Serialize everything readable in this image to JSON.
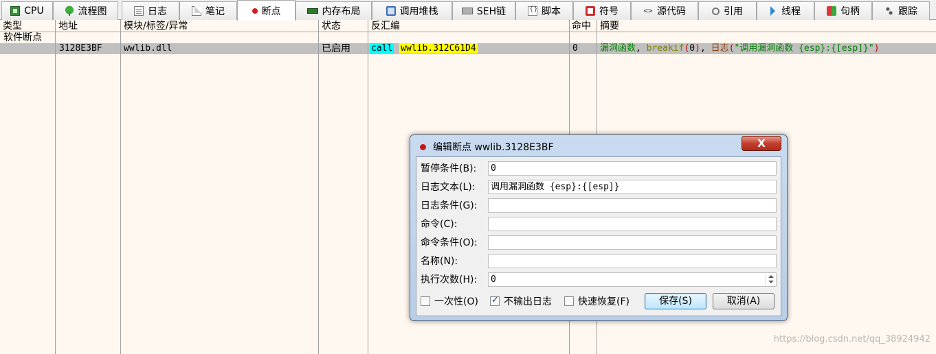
{
  "tabs": [
    {
      "label": "CPU",
      "icon": "cpu-icon"
    },
    {
      "label": "流程图",
      "icon": "graph-icon"
    },
    {
      "label": "日志",
      "icon": "log-icon"
    },
    {
      "label": "笔记",
      "icon": "notes-icon"
    },
    {
      "label": "断点",
      "icon": "breakpoint-icon",
      "active": true
    },
    {
      "label": "内存布局",
      "icon": "memory-map-icon"
    },
    {
      "label": "调用堆栈",
      "icon": "call-stack-icon"
    },
    {
      "label": "SEH链",
      "icon": "seh-icon"
    },
    {
      "label": "脚本",
      "icon": "script-icon"
    },
    {
      "label": "符号",
      "icon": "symbols-icon"
    },
    {
      "label": "源代码",
      "icon": "source-icon"
    },
    {
      "label": "引用",
      "icon": "references-icon"
    },
    {
      "label": "线程",
      "icon": "threads-icon"
    },
    {
      "label": "句柄",
      "icon": "handles-icon"
    },
    {
      "label": "跟踪",
      "icon": "trace-icon"
    }
  ],
  "table": {
    "columns": [
      "类型",
      "地址",
      "模块/标签/异常",
      "状态",
      "反汇编",
      "命中",
      "摘要"
    ],
    "group_label": "软件断点",
    "rows": [
      {
        "address": "3128E3BF",
        "module": "wwlib.dll",
        "status": "已启用",
        "disasm": {
          "mnemonic": "call",
          "operand": "wwlib.312C61D4"
        },
        "hits": "0",
        "summary": {
          "name": "漏洞函数",
          "sep1": ", ",
          "breakif": "breakif",
          "open1": "(",
          "breakif_arg": "0",
          "close1": ")",
          "sep2": ", ",
          "log": "日志",
          "open2": "(",
          "log_arg": "\"调用漏洞函数 {esp}:{[esp]}\"",
          "close2": ")"
        }
      }
    ]
  },
  "dialog": {
    "title": "编辑断点 wwlib.3128E3BF",
    "close_label": "X",
    "fields": [
      {
        "label": "暂停条件(B):",
        "value": "0"
      },
      {
        "label": "日志文本(L):",
        "value": "调用漏洞函数 {esp}:{[esp]}"
      },
      {
        "label": "日志条件(G):",
        "value": ""
      },
      {
        "label": "命令(C):",
        "value": ""
      },
      {
        "label": "命令条件(O):",
        "value": ""
      },
      {
        "label": "名称(N):",
        "value": ""
      },
      {
        "label": "执行次数(H):",
        "value": "0"
      }
    ],
    "checkboxes": [
      {
        "label": "一次性(O)",
        "checked": false
      },
      {
        "label": "不输出日志",
        "checked": true
      },
      {
        "label": "快速恢复(F)",
        "checked": false
      }
    ],
    "save_label": "保存(S)",
    "cancel_label": "取消(A)"
  },
  "watermark": "https://blog.csdn.net/qq_38924942",
  "colors": {
    "background": "#fff8f0",
    "selected_row": "#c0c0c0",
    "mnemonic_highlight": "#00ffff",
    "operand_highlight": "#ffff00",
    "summary_green": "#008000",
    "summary_olive": "#808000",
    "summary_red": "#c00000",
    "dialog_frame": "#c9dbf0",
    "close_button": "#c24030"
  }
}
